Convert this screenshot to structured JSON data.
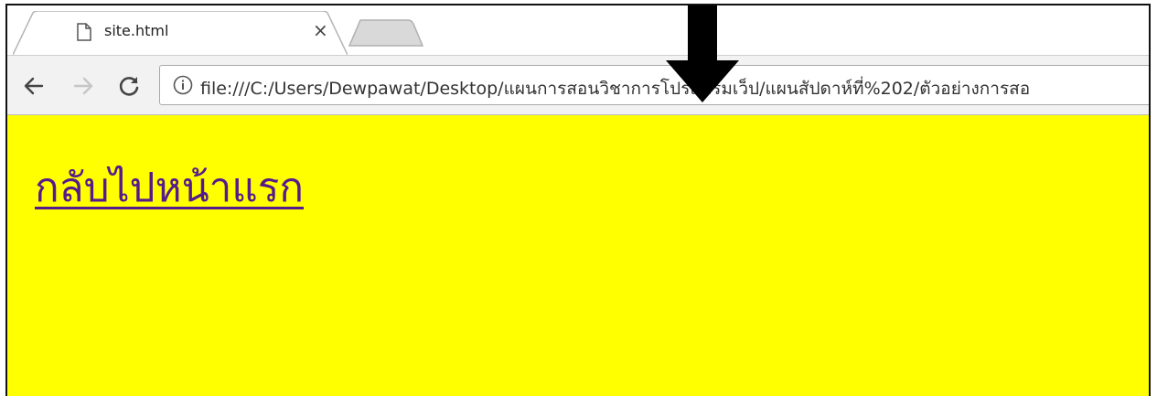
{
  "browser": {
    "tab": {
      "title": "site.html",
      "close_glyph": "×",
      "icon": "document-icon"
    },
    "toolbar": {
      "back_icon": "arrow-left-icon",
      "forward_icon": "arrow-right-icon",
      "reload_icon": "reload-icon",
      "info_icon": "info-icon",
      "url": "file:///C:/Users/Dewpawat/Desktop/แผนการสอนวิชาการโปรแกรมเว็ป/แผนสัปดาห์ที่%202/ตัวอย่างการสอ"
    }
  },
  "page": {
    "background_color": "#ffff00",
    "link_text": "กลับไปหน้าแรก",
    "link_color": "#551a8b"
  },
  "annotation": {
    "arrow_icon": "arrow-down-icon",
    "arrow_color": "#000000"
  }
}
